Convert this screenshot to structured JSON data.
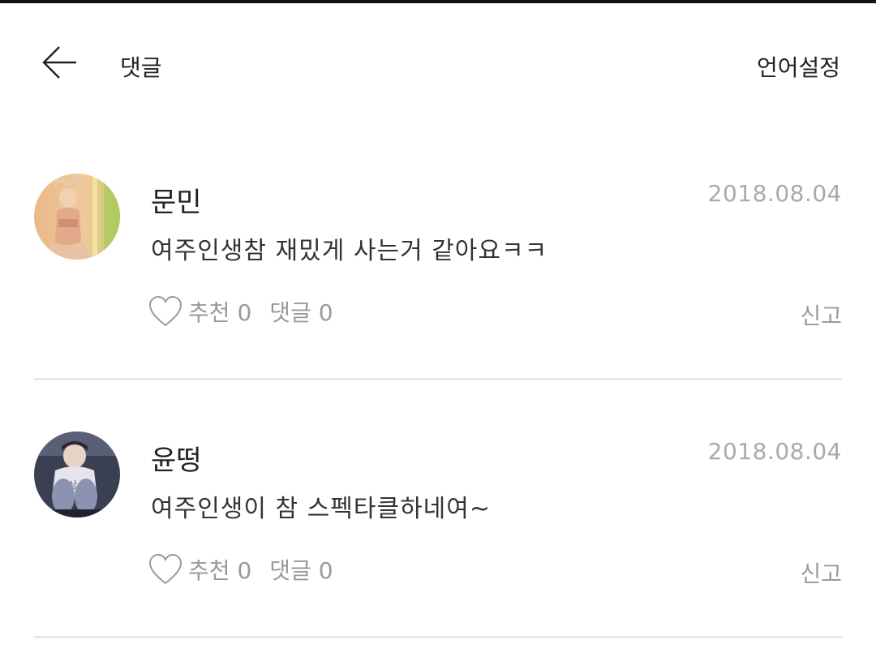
{
  "header": {
    "title": "댓글",
    "language_button": "언어설정"
  },
  "comments": [
    {
      "author": "문민",
      "date": "2018.08.04",
      "text": "여주인생참 재밌게 사는거 같아요ㅋㅋ",
      "likes_label": "추천",
      "likes_count": "0",
      "replies_label": "댓글",
      "replies_count": "0",
      "report_label": "신고"
    },
    {
      "author": "윤떵",
      "date": "2018.08.04",
      "text": "여주인생이 참 스펙타클하네여~",
      "likes_label": "추천",
      "likes_count": "0",
      "replies_label": "댓글",
      "replies_count": "0",
      "report_label": "신고"
    }
  ],
  "icons": {
    "back": "arrow-left-icon",
    "like": "heart-outline-icon"
  },
  "colors": {
    "meta_gray": "#9a9a9a",
    "date_gray": "#aaaaaa",
    "divider": "#e8e8e8"
  }
}
